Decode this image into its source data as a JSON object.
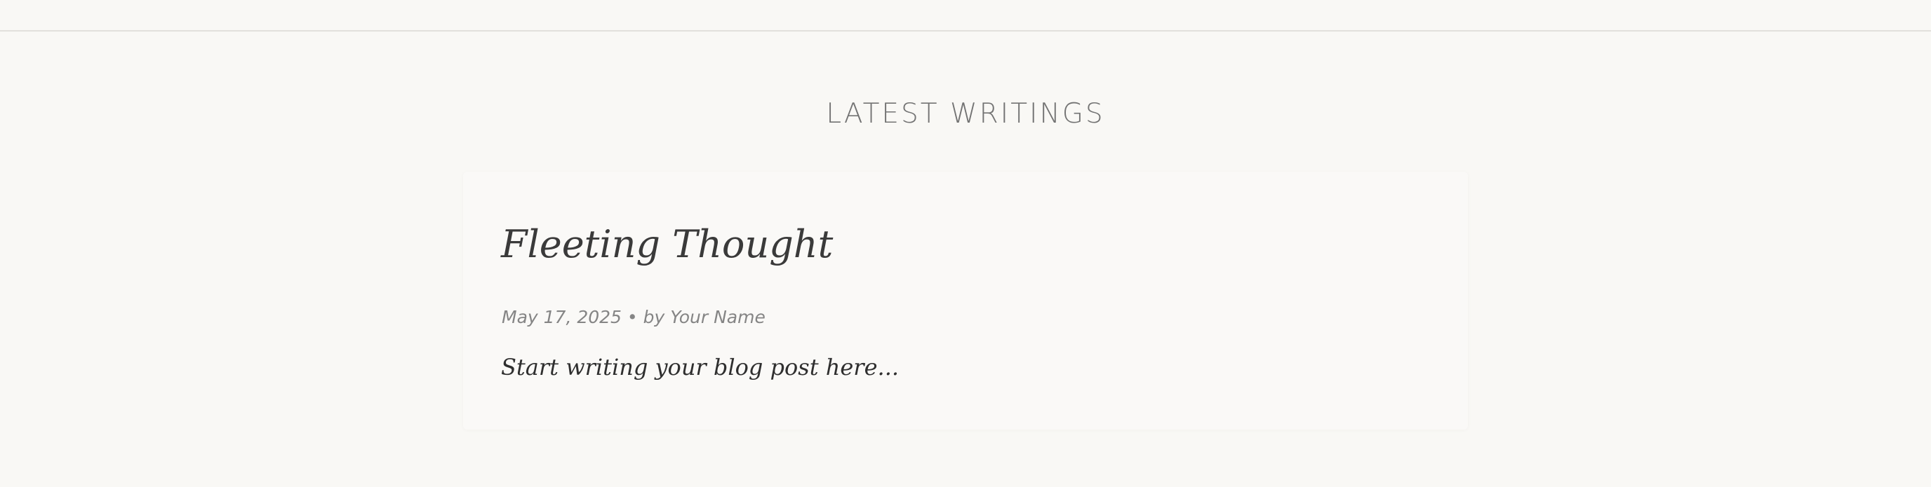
{
  "section": {
    "title": "LATEST WRITINGS"
  },
  "posts": [
    {
      "title": "Fleeting Thought",
      "meta": "May 17, 2025 • by Your Name",
      "excerpt": "Start writing your blog post here..."
    }
  ]
}
